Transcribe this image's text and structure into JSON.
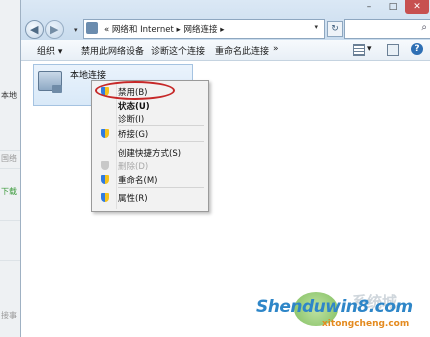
{
  "left_window": {
    "text_top": "本地",
    "text_mid1": "国络",
    "text_mid2": "下载",
    "text_bottom": "接事"
  },
  "window_controls": {
    "minimize": "–",
    "maximize": "□",
    "close": "✕"
  },
  "address_bar": {
    "path": "« 网络和 Internet ▸ 网络连接 ▸",
    "dropdown": "▾",
    "refresh": "↻",
    "search_placeholder": ""
  },
  "toolbar": {
    "organize": "组织 ▾",
    "disable_device": "禁用此网络设备",
    "diagnose": "诊断这个连接",
    "rename": "重命名此连接",
    "more": "»",
    "view_dropdown": "▾",
    "help": "?"
  },
  "connection": {
    "name": "本地连接"
  },
  "context_menu": {
    "items": [
      {
        "label": "禁用(B)",
        "style": "normal",
        "icon": "shield-icon"
      },
      {
        "label": "状态(U)",
        "style": "bold"
      },
      {
        "label": "诊断(I)",
        "style": "normal"
      },
      {
        "label": "桥接(G)",
        "style": "normal",
        "icon": "shield-icon"
      },
      {
        "label": "创建快捷方式(S)",
        "style": "normal"
      },
      {
        "label": "删除(D)",
        "style": "disabled",
        "icon": "shield-icon"
      },
      {
        "label": "重命名(M)",
        "style": "normal",
        "icon": "shield-icon"
      },
      {
        "label": "属性(R)",
        "style": "normal",
        "icon": "shield-icon"
      }
    ]
  },
  "watermark": {
    "main": "Shenduwin8.com",
    "sub": "xitongcheng.com",
    "logo_text": "系统城"
  },
  "colors": {
    "highlight_ring": "#c62828",
    "accent": "#2e86c8"
  }
}
